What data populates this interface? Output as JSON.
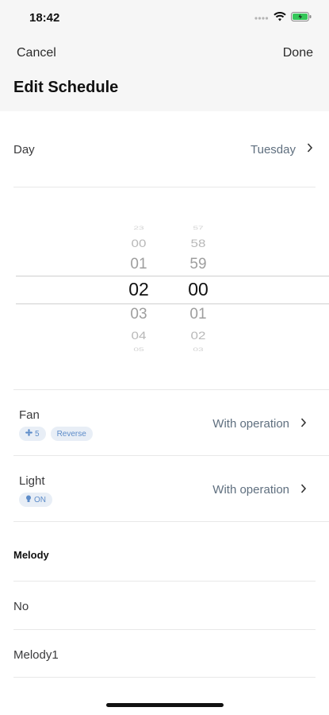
{
  "status_bar": {
    "time": "18:42"
  },
  "nav": {
    "cancel": "Cancel",
    "done": "Done",
    "title": "Edit Schedule"
  },
  "day": {
    "label": "Day",
    "value": "Tuesday"
  },
  "picker": {
    "hours": [
      "23",
      "00",
      "01",
      "02",
      "03",
      "04",
      "05"
    ],
    "minutes": [
      "57",
      "58",
      "59",
      "00",
      "01",
      "02",
      "03"
    ],
    "selected_hour": "02",
    "selected_minute": "00"
  },
  "fan": {
    "label": "Fan",
    "value": "With operation",
    "speed_badge": "5",
    "direction_badge": "Reverse"
  },
  "light": {
    "label": "Light",
    "value": "With operation",
    "badge": "ON"
  },
  "melody": {
    "header": "Melody",
    "options": [
      "No",
      "Melody1"
    ]
  }
}
